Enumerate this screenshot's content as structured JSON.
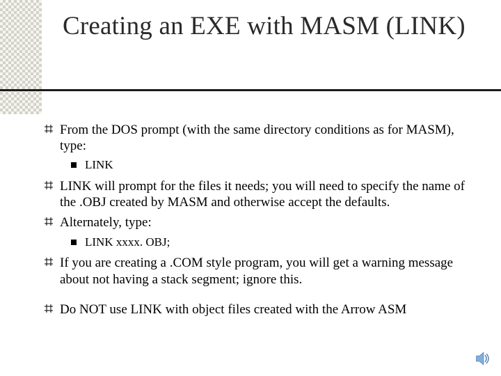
{
  "title": "Creating an EXE with MASM (LINK)",
  "bullets": {
    "b1": "From the DOS prompt (with the same directory conditions as for MASM), type:",
    "b1sub": "LINK",
    "b2": "LINK will prompt for the files it needs; you will need to specify the name of the .OBJ created by MASM and otherwise accept the defaults.",
    "b3": "Alternately, type:",
    "b3sub": "LINK  xxxx. OBJ;",
    "b4": "If you are creating a .COM style program, you will get a warning message about not having a stack segment; ignore this.",
    "b5": "Do NOT use LINK with object files created with the Arrow ASM"
  }
}
